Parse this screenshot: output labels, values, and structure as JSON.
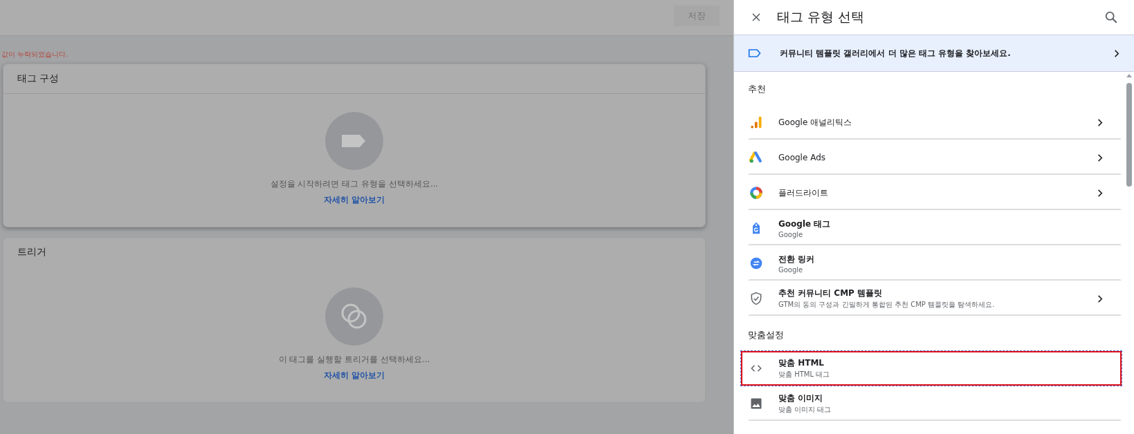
{
  "toolbar": {
    "save_button": "저장"
  },
  "error_message": "값이 누락되었습니다.",
  "cards": [
    {
      "title": "태그 구성",
      "hint": "설정을 시작하려면 태그 유형을 선택하세요...",
      "link": "자세히 알아보기"
    },
    {
      "title": "트리거",
      "hint": "이 태그를 실행할 트리거를 선택하세요...",
      "link": "자세히 알아보기"
    }
  ],
  "panel": {
    "title": "태그 유형 선택",
    "banner": "커뮤니티 템플릿 갤러리에서 더 많은 태그 유형을 찾아보세요.",
    "sections": [
      {
        "title": "추천",
        "items": [
          {
            "title": "Google 애널리틱스",
            "chevron": true,
            "selected": false
          },
          {
            "title": "Google Ads",
            "chevron": true,
            "selected": false
          },
          {
            "title": "플러드라이트",
            "chevron": true,
            "selected": false
          },
          {
            "title": "Google 태그",
            "subtitle": "Google",
            "chevron": false,
            "selected": false
          },
          {
            "title": "전환 링커",
            "subtitle": "Google",
            "chevron": false,
            "selected": false
          },
          {
            "title": "추천 커뮤니티 CMP 템플릿",
            "subtitle": "GTM의 동의 구성과 긴밀하게 통합된 추천 CMP 템플릿을 탐색하세요.",
            "chevron": true,
            "selected": false
          }
        ]
      },
      {
        "title": "맞춤설정",
        "items": [
          {
            "title": "맞춤 HTML",
            "subtitle": "맞춤 HTML 태그",
            "chevron": false,
            "selected": true
          },
          {
            "title": "맞춤 이미지",
            "subtitle": "맞춤 이미지 태그",
            "chevron": false,
            "selected": false
          }
        ]
      }
    ]
  }
}
